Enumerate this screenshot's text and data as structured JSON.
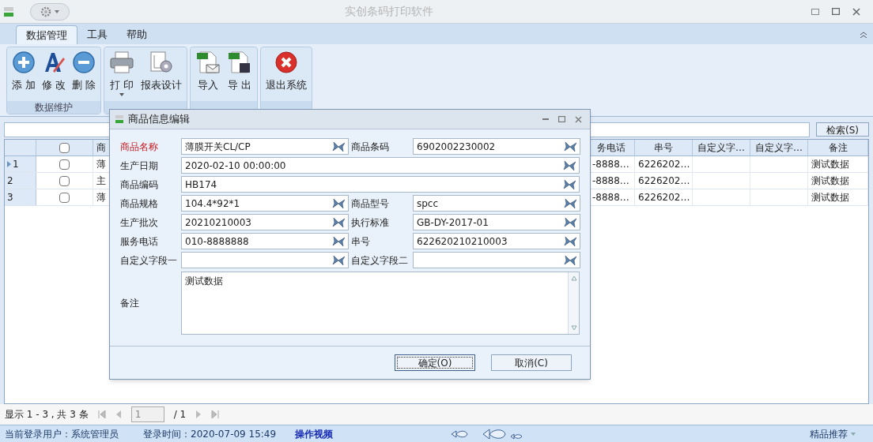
{
  "window": {
    "title": "实创条码打印软件"
  },
  "tabs": [
    {
      "label": "数据管理",
      "selected": true
    },
    {
      "label": "工具",
      "selected": false
    },
    {
      "label": "帮助",
      "selected": false
    }
  ],
  "ribbon_groups": [
    {
      "label": "数据维护",
      "buttons": [
        {
          "label": "添 加",
          "kind": "add",
          "dropdown": false
        },
        {
          "label": "修 改",
          "kind": "edit",
          "dropdown": false
        },
        {
          "label": "删 除",
          "kind": "delete",
          "dropdown": false
        }
      ]
    },
    {
      "buttons": [
        {
          "label": "打 印",
          "kind": "print",
          "dropdown": true
        },
        {
          "label": "报表设计",
          "kind": "design",
          "dropdown": false
        }
      ]
    },
    {
      "buttons": [
        {
          "label": "导入",
          "kind": "import",
          "dropdown": false
        },
        {
          "label": "导 出",
          "kind": "export",
          "dropdown": false
        }
      ]
    },
    {
      "buttons": [
        {
          "label": "退出系统",
          "kind": "exit",
          "dropdown": false
        }
      ]
    }
  ],
  "search": {
    "button": "检索(S)"
  },
  "table": {
    "select_all_checked": false,
    "columns": [
      "商",
      "务电话",
      "串号",
      "自定义字…",
      "自定义字…",
      "备注"
    ],
    "rows": [
      {
        "number": "1",
        "selected": true,
        "checked": false,
        "cells": [
          "薄",
          "-8888…",
          "6226202…",
          "",
          "",
          "测试数据"
        ]
      },
      {
        "number": "2",
        "selected": false,
        "checked": false,
        "cells": [
          "主",
          "-8888…",
          "6226202…",
          "",
          "",
          "测试数据"
        ]
      },
      {
        "number": "3",
        "selected": false,
        "checked": false,
        "cells": [
          "薄",
          "-8888…",
          "6226202…",
          "",
          "",
          "测试数据"
        ]
      }
    ]
  },
  "dialog": {
    "title": "商品信息编辑",
    "rows": [
      [
        {
          "label": "商品名称",
          "value": "薄膜开关CL/CP",
          "required": true
        },
        {
          "label": "商品条码",
          "value": "6902002230002",
          "required": false
        }
      ],
      [
        {
          "label": "生产日期",
          "value": "2020-02-10 00:00:00",
          "required": false
        }
      ],
      [
        {
          "label": "商品编码",
          "value": "HB174",
          "required": false
        }
      ],
      [
        {
          "label": "商品规格",
          "value": "104.4*92*1",
          "required": false
        },
        {
          "label": "商品型号",
          "value": "spcc",
          "required": false
        }
      ],
      [
        {
          "label": "生产批次",
          "value": "20210210003",
          "required": false
        },
        {
          "label": "执行标准",
          "value": "GB-DY-2017-01",
          "required": false
        }
      ],
      [
        {
          "label": "服务电话",
          "value": "010-8888888",
          "required": false
        },
        {
          "label": "串号",
          "value": "622620210210003",
          "required": false
        }
      ],
      [
        {
          "label": "自定义字段一",
          "required": false
        },
        {
          "label": "自定义字段二",
          "required": false
        }
      ]
    ],
    "notes": {
      "label": "备注",
      "value": "测试数据"
    },
    "buttons": [
      "确定(O)",
      "取消(C)"
    ]
  },
  "pager": {
    "summary": "显示 1 - 3 , 共 3 条",
    "page": "1",
    "total": "/ 1"
  },
  "status_bar": {
    "user": "当前登录用户：系统管理员",
    "login_time": "登录时间：2020-07-09 15:49",
    "video_link": "操作视频",
    "recommend": "精品推荐"
  }
}
